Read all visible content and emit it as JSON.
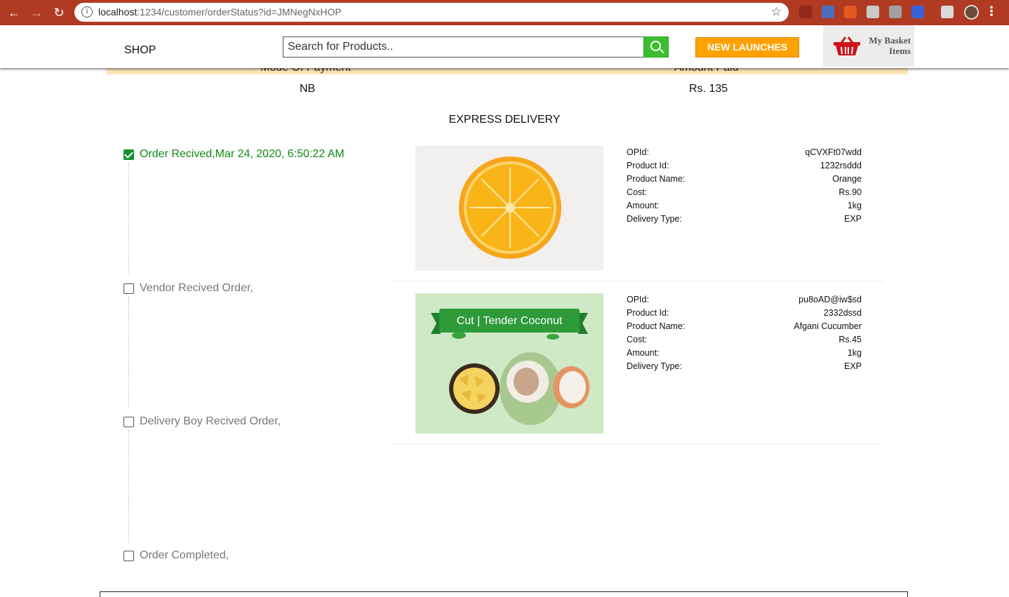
{
  "browser": {
    "url_host": "localhost",
    "url_path": ":1234/customer/orderStatus?id=JMNegNxHOP"
  },
  "header": {
    "brand": "SHOP",
    "search_placeholder": "Search for Products..",
    "new_launches_label": "NEW LAUNCHES",
    "basket_label_line1": "My Basket",
    "basket_label_line2": "Items"
  },
  "payment": {
    "mode_header": "Mode Of Payment",
    "amount_header": "Amount Paid",
    "mode_value": "NB",
    "amount_value": "Rs. 135"
  },
  "delivery_title": "EXPRESS DELIVERY",
  "timeline": [
    {
      "label": "Order Recived,Mar 24, 2020, 6:50:22 AM",
      "checked": true
    },
    {
      "label": "Vendor Recived Order,",
      "checked": false
    },
    {
      "label": "Delivery Boy Recived Order,",
      "checked": false
    },
    {
      "label": "Order Completed,",
      "checked": false
    }
  ],
  "products": [
    {
      "image_alt": "orange",
      "fields": [
        {
          "key": "OPId:",
          "value": "qCVXFt07wdd"
        },
        {
          "key": "Product Id:",
          "value": "1232rsddd"
        },
        {
          "key": "Product Name:",
          "value": "Orange"
        },
        {
          "key": "Cost:",
          "value": "Rs.90"
        },
        {
          "key": "Amount:",
          "value": "1kg"
        },
        {
          "key": "Delivery Type:",
          "value": "EXP"
        }
      ]
    },
    {
      "image_alt": "tender-coconut",
      "banner_text": "Cut | Tender Coconut",
      "fields": [
        {
          "key": "OPId:",
          "value": "pu8oAD@iw$sd"
        },
        {
          "key": "Product Id:",
          "value": "2332dssd"
        },
        {
          "key": "Product Name:",
          "value": "Afgani Cucumber"
        },
        {
          "key": "Cost:",
          "value": "Rs.45"
        },
        {
          "key": "Amount:",
          "value": "1kg"
        },
        {
          "key": "Delivery Type:",
          "value": "EXP"
        }
      ]
    }
  ],
  "colors": {
    "chrome": "#b13a23",
    "accent_orange": "#ffa100",
    "search_green": "#3bbf2f",
    "done_green": "#0f8a16",
    "payment_band": "#fae5b5"
  }
}
